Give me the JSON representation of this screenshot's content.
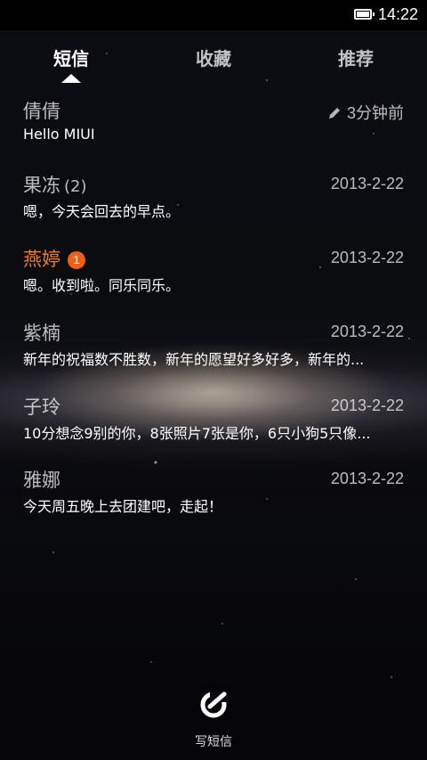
{
  "status_bar": {
    "time": "14:22",
    "battery_icon": "battery-full-icon"
  },
  "tabs": [
    {
      "label": "短信",
      "active": true
    },
    {
      "label": "收藏",
      "active": false
    },
    {
      "label": "推荐",
      "active": false
    }
  ],
  "conversations": [
    {
      "name": "倩倩",
      "count": "",
      "unread_badge": "",
      "time": "3分钟前",
      "draft_icon": "pencil-icon",
      "snippet": "Hello MIUI"
    },
    {
      "name": "果冻",
      "count": "(2)",
      "unread_badge": "",
      "time": "2013-2-22",
      "snippet": "嗯，今天会回去的早点。"
    },
    {
      "name": "燕婷",
      "count": "",
      "unread_badge": "1",
      "time": "2013-2-22",
      "snippet": "嗯。收到啦。同乐同乐。",
      "unread_color": "#f07d22"
    },
    {
      "name": "紫楠",
      "count": "",
      "unread_badge": "",
      "time": "2013-2-22",
      "snippet": "新年的祝福数不胜数，新年的愿望好多好多，新年的..."
    },
    {
      "name": "子玲",
      "count": "",
      "unread_badge": "",
      "time": "2013-2-22",
      "snippet": "10分想念9别的你，8张照片7张是你，6只小狗5只像..."
    },
    {
      "name": "雅娜",
      "count": "",
      "unread_badge": "",
      "time": "2013-2-22",
      "snippet": "今天周五晚上去团建吧，走起！"
    }
  ],
  "compose": {
    "label": "写短信",
    "icon": "compose-icon"
  }
}
